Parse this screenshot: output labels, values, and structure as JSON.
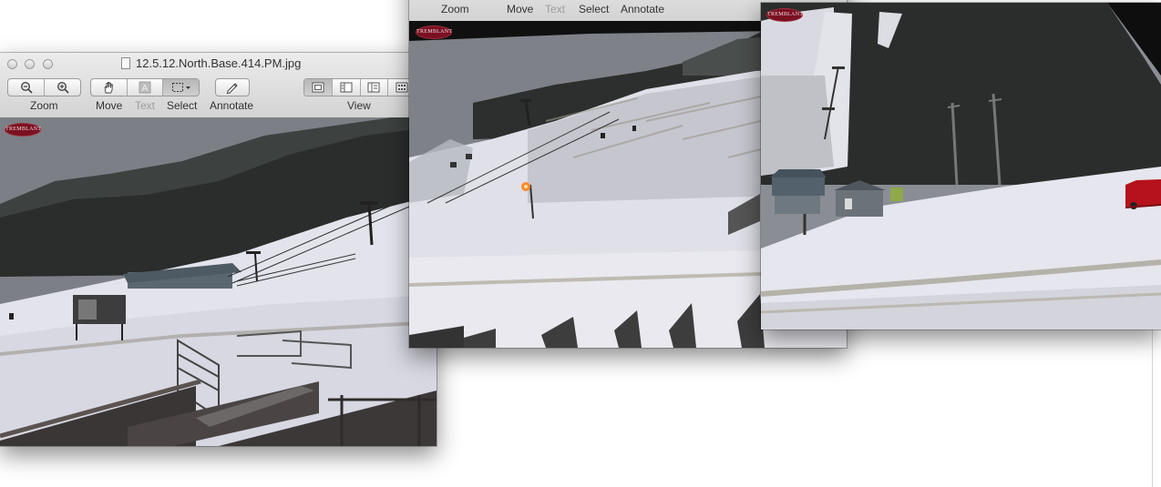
{
  "windows": [
    {
      "id": "left",
      "title": "12.5.12.North.Base.414.PM.jpg",
      "toolbar": {
        "zoom_label": "Zoom",
        "move_label": "Move",
        "text_label": "Text",
        "select_label": "Select",
        "annotate_label": "Annotate",
        "view_label": "View"
      },
      "logo_text": "TREMBLANT"
    },
    {
      "id": "middle",
      "toolbar": {
        "zoom_label": "Zoom",
        "move_label": "Move",
        "text_label": "Text",
        "select_label": "Select",
        "annotate_label": "Annotate"
      },
      "logo_text": "TREMBLANT"
    },
    {
      "id": "right",
      "logo_text": "TREMBLANT"
    }
  ],
  "colors": {
    "toolbar_top": "#ececec",
    "toolbar_bottom": "#d3d3d3",
    "snow": "#e8e8ef",
    "sky": "#7f8389",
    "forest": "#2b2e2c",
    "logo": "#7a1122",
    "car": "#b5121b"
  }
}
